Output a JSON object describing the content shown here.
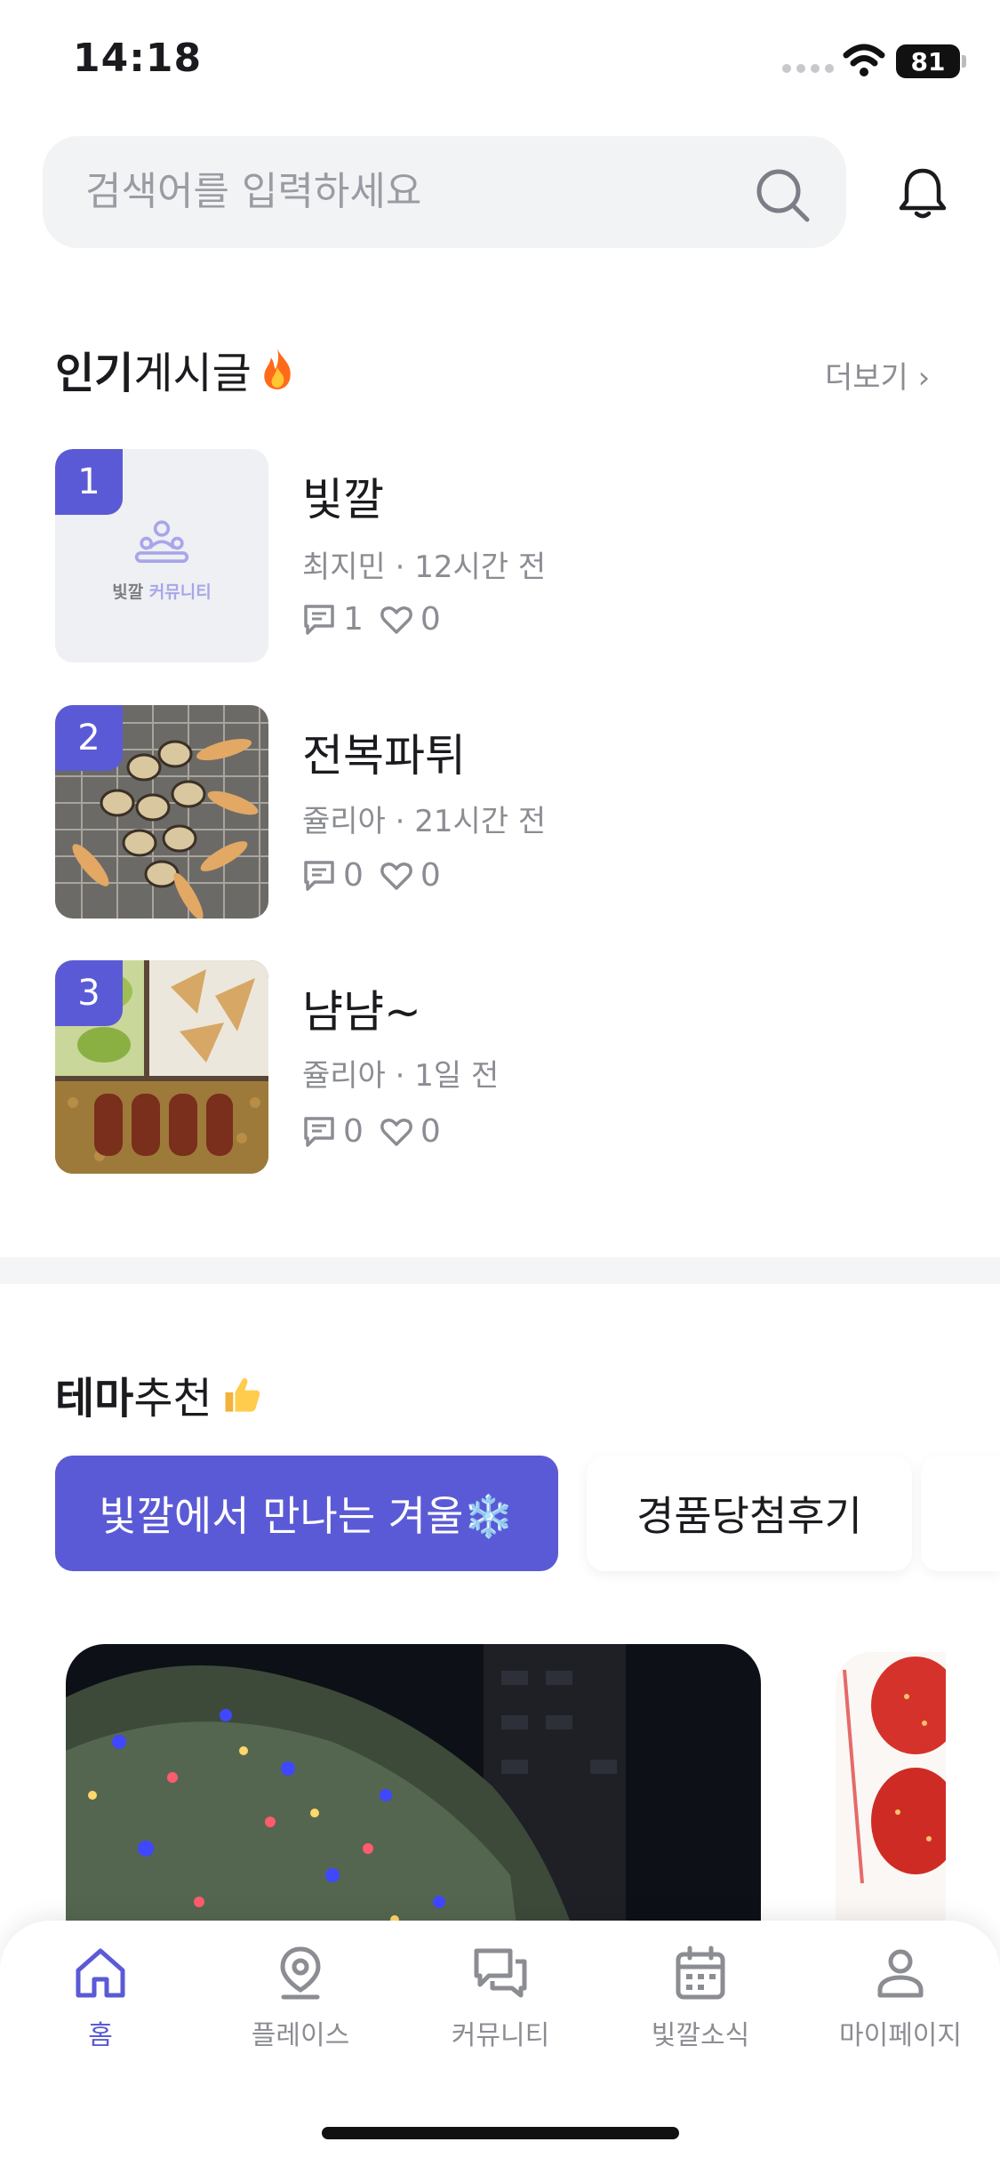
{
  "status_bar": {
    "time": "14:18",
    "battery": "81"
  },
  "search": {
    "placeholder": "검색어를 입력하세요"
  },
  "popular": {
    "title_bold": "인기",
    "title_rest": "게시글",
    "more_label": "더보기 ›",
    "posts": [
      {
        "rank": "1",
        "title": "빛깔",
        "meta": "최지민 · 12시간 전",
        "comments": "1",
        "likes": "0",
        "placeholder_label_a": "빛깔",
        "placeholder_label_b": "커뮤니티"
      },
      {
        "rank": "2",
        "title": "전복파튀",
        "meta": "쥴리아 · 21시간 전",
        "comments": "0",
        "likes": "0"
      },
      {
        "rank": "3",
        "title": "냠냠~",
        "meta": "쥴리아 · 1일 전",
        "comments": "0",
        "likes": "0"
      }
    ]
  },
  "theme": {
    "title_bold": "테마",
    "title_rest": "추천",
    "chips": [
      {
        "label": "빛깔에서 만나는 겨울❄️",
        "active": true
      },
      {
        "label": "경품당첨후기",
        "active": false
      }
    ]
  },
  "tabs": [
    {
      "label": "홈",
      "icon": "home-icon",
      "active": true
    },
    {
      "label": "플레이스",
      "icon": "location-pin-icon",
      "active": false
    },
    {
      "label": "커뮤니티",
      "icon": "chat-icon",
      "active": false
    },
    {
      "label": "빛깔소식",
      "icon": "calendar-icon",
      "active": false
    },
    {
      "label": "마이페이지",
      "icon": "person-icon",
      "active": false
    }
  ],
  "colors": {
    "accent": "#5b5ad6",
    "muted": "#8b8d93",
    "search_bg": "#f2f3f5"
  }
}
